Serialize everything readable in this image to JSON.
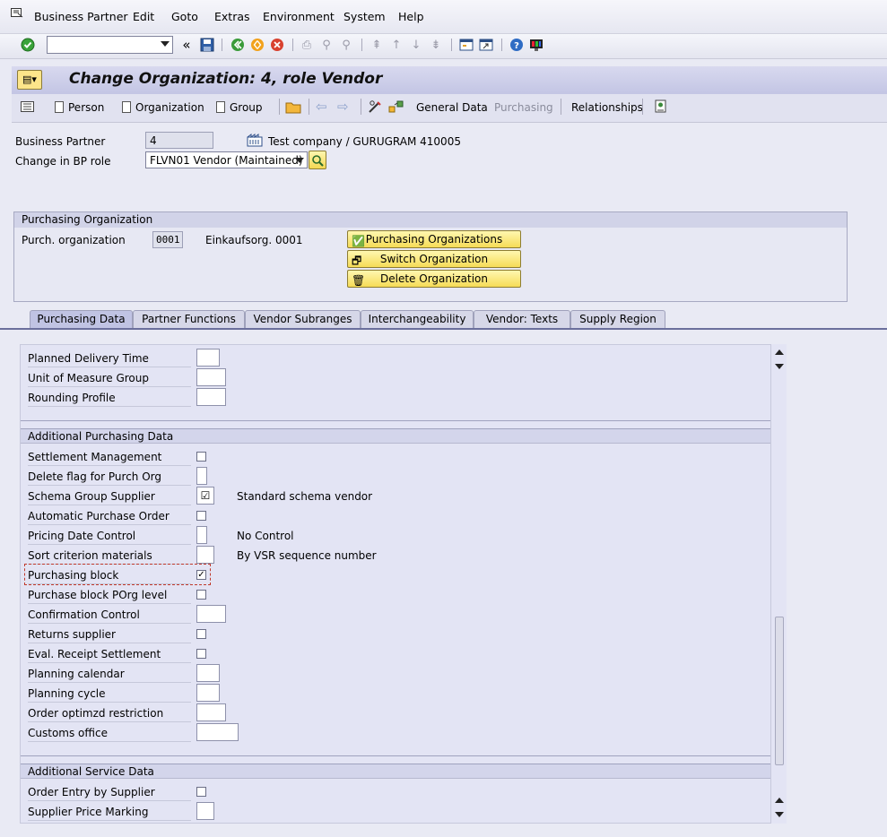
{
  "menu": {
    "items": [
      "Business Partner",
      "Edit",
      "Goto",
      "Extras",
      "Environment",
      "System",
      "Help"
    ]
  },
  "toolbar": {
    "command_field_value": "",
    "back_glyph": "«"
  },
  "title": {
    "text": "Change Organization: 4, role Vendor"
  },
  "app_toolbar": {
    "person": "Person",
    "organization": "Organization",
    "group": "Group",
    "general_data": "General Data",
    "purchasing": "Purchasing",
    "relationships": "Relationships"
  },
  "header": {
    "bp_label": "Business Partner",
    "bp_value": "4",
    "bp_desc": "Test company / GURUGRAM 410005",
    "role_label": "Change in BP role",
    "role_value": "FLVN01 Vendor (Maintained)"
  },
  "porg": {
    "group_title": "Purchasing Organization",
    "label": "Purch. organization",
    "value": "0001",
    "desc": "Einkaufsorg. 0001",
    "btn_orgs": "Purchasing Organizations",
    "btn_switch": "Switch Organization",
    "btn_delete": "Delete Organization"
  },
  "tabs": [
    "Purchasing Data",
    "Partner Functions",
    "Vendor Subranges",
    "Interchangeability",
    "Vendor: Texts",
    "Supply Region"
  ],
  "section_top": {
    "rows": [
      "Planned Delivery Time",
      "Unit of Measure Group",
      "Rounding Profile"
    ]
  },
  "section_additional": {
    "title": "Additional Purchasing Data",
    "rows": [
      {
        "label": "Settlement Management",
        "desc": ""
      },
      {
        "label": "Delete flag for Purch Org",
        "desc": ""
      },
      {
        "label": "Schema Group Supplier",
        "desc": "Standard schema vendor"
      },
      {
        "label": "Automatic Purchase Order",
        "desc": ""
      },
      {
        "label": "Pricing Date Control",
        "desc": "No Control"
      },
      {
        "label": "Sort criterion materials",
        "desc": "By VSR sequence number"
      },
      {
        "label": "Purchasing block",
        "desc": ""
      },
      {
        "label": "Purchase block POrg level",
        "desc": ""
      },
      {
        "label": "Confirmation Control",
        "desc": ""
      },
      {
        "label": "Returns supplier",
        "desc": ""
      },
      {
        "label": "Eval. Receipt Settlement",
        "desc": ""
      },
      {
        "label": "Planning calendar",
        "desc": ""
      },
      {
        "label": "Planning cycle",
        "desc": ""
      },
      {
        "label": "Order optimzd restriction",
        "desc": ""
      },
      {
        "label": "Customs office",
        "desc": ""
      }
    ]
  },
  "section_service": {
    "title": "Additional Service Data",
    "rows": [
      "Order Entry by Supplier",
      "Supplier Price Marking"
    ]
  },
  "checks": {
    "schema_group_supplier": true,
    "purchasing_block": true
  }
}
